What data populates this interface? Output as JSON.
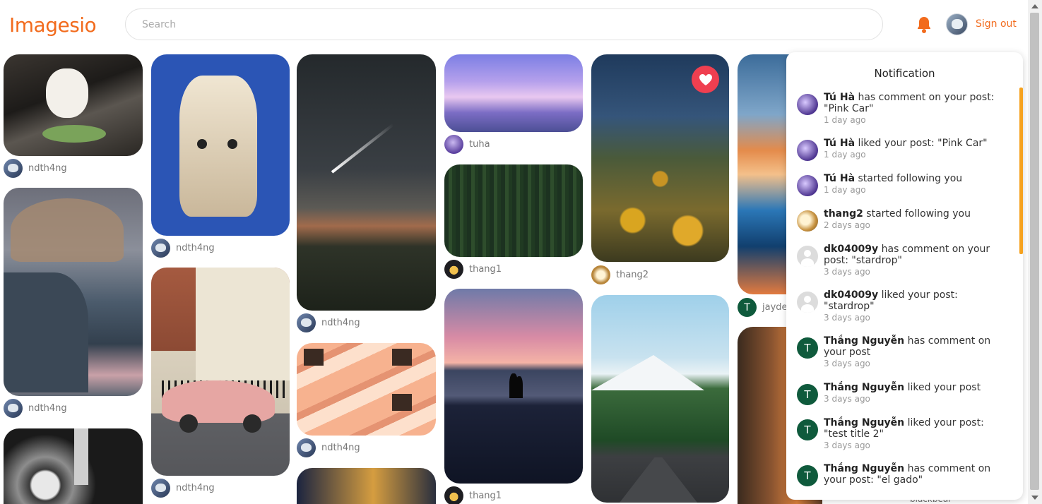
{
  "app": {
    "logo": "Imagesio",
    "sign_out": "Sign out",
    "search_placeholder": "Search",
    "accent_color": "#f26b1d"
  },
  "cards": [
    {
      "user": "ndth4ng"
    },
    {
      "user": "ndth4ng"
    },
    {
      "user": "ndth4ng"
    },
    {
      "user": "ndth4ng"
    },
    {
      "user": "ndth4ng"
    },
    {
      "user": "ndth4ng"
    },
    {
      "user": "tuha"
    },
    {
      "user": "thang1"
    },
    {
      "user": "thang1"
    },
    {
      "user": "thang2"
    },
    {
      "user": "jayde"
    },
    {
      "user": "blackbear"
    }
  ],
  "notifications": {
    "title": "Notification",
    "items": [
      {
        "user": "Tú Hà",
        "text": "has comment on your post: \"Pink Car\"",
        "time": "1 day ago",
        "avatar": "purple"
      },
      {
        "user": "Tú Hà",
        "text": "liked your post: \"Pink Car\"",
        "time": "1 day ago",
        "avatar": "purple"
      },
      {
        "user": "Tú Hà",
        "text": "started following you",
        "time": "1 day ago",
        "avatar": "purple"
      },
      {
        "user": "thang2",
        "text": "started following you",
        "time": "2 days ago",
        "avatar": "gold"
      },
      {
        "user": "dk04009y",
        "text": "has comment on your post: \"stardrop\"",
        "time": "3 days ago",
        "avatar": "gray"
      },
      {
        "user": "dk04009y",
        "text": "liked your post: \"stardrop\"",
        "time": "3 days ago",
        "avatar": "gray"
      },
      {
        "user": "Thắng Nguyễn",
        "text": "has comment on your post",
        "time": "3 days ago",
        "avatar": "green"
      },
      {
        "user": "Thắng Nguyễn",
        "text": "liked your post",
        "time": "3 days ago",
        "avatar": "green"
      },
      {
        "user": "Thắng Nguyễn",
        "text": "liked your post: \"test title 2\"",
        "time": "3 days ago",
        "avatar": "green"
      },
      {
        "user": "Thắng Nguyễn",
        "text": "has comment on your post: \"el gado\"",
        "time": "",
        "avatar": "green"
      }
    ],
    "avatar_letter": "T"
  }
}
